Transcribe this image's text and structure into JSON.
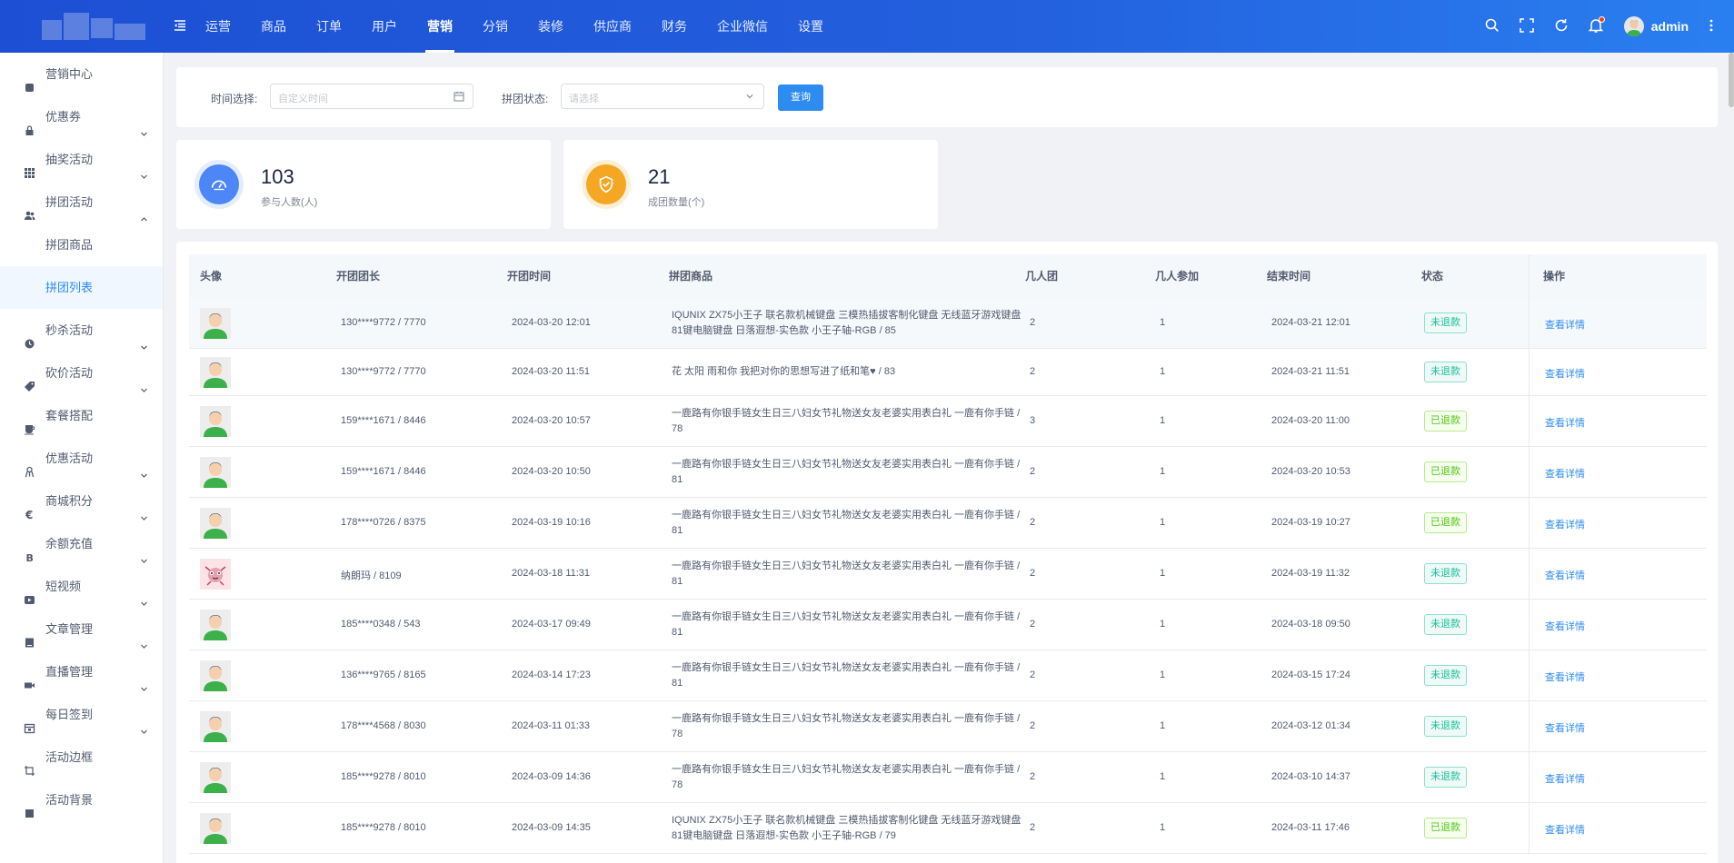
{
  "topbar": {
    "nav": [
      "运营",
      "商品",
      "订单",
      "用户",
      "营销",
      "分销",
      "装修",
      "供应商",
      "财务",
      "企业微信",
      "设置"
    ],
    "active_index": 4,
    "user": "admin"
  },
  "sidebar": {
    "items": [
      {
        "label": "营销中心",
        "icon": "shop-icon",
        "chevron": false
      },
      {
        "label": "优惠券",
        "icon": "lock-icon",
        "chevron": true
      },
      {
        "label": "抽奖活动",
        "icon": "grid-icon",
        "chevron": true
      },
      {
        "label": "拼团活动",
        "icon": "group-icon",
        "chevron": "up",
        "children": [
          {
            "label": "拼团商品",
            "active": false
          },
          {
            "label": "拼团列表",
            "active": true
          }
        ]
      },
      {
        "label": "秒杀活动",
        "icon": "clock-icon",
        "chevron": true
      },
      {
        "label": "砍价活动",
        "icon": "tag-icon",
        "chevron": true
      },
      {
        "label": "套餐搭配",
        "icon": "cup-icon",
        "chevron": false
      },
      {
        "label": "优惠活动",
        "icon": "gift-icon",
        "chevron": true
      },
      {
        "label": "商城积分",
        "icon": "euro-icon",
        "chevron": true
      },
      {
        "label": "余额充值",
        "icon": "bitcoin-icon",
        "chevron": true
      },
      {
        "label": "短视频",
        "icon": "video-icon",
        "chevron": true
      },
      {
        "label": "文章管理",
        "icon": "book-icon",
        "chevron": true
      },
      {
        "label": "直播管理",
        "icon": "camera-icon",
        "chevron": true
      },
      {
        "label": "每日签到",
        "icon": "calendar-icon",
        "chevron": true
      },
      {
        "label": "活动边框",
        "icon": "frame-icon",
        "chevron": false
      },
      {
        "label": "活动背景",
        "icon": "square-icon",
        "chevron": false
      }
    ]
  },
  "filter": {
    "time_label": "时间选择:",
    "time_placeholder": "自定义时间",
    "status_label": "拼团状态:",
    "status_placeholder": "请选择",
    "query": "查询"
  },
  "stats": [
    {
      "value": "103",
      "label": "参与人数(人)",
      "color": "#2d7cf6"
    },
    {
      "value": "21",
      "label": "成团数量(个)",
      "color": "#f5a623"
    }
  ],
  "table": {
    "columns": [
      "头像",
      "开团团长",
      "开团时间",
      "拼团商品",
      "几人团",
      "几人参加",
      "结束时间",
      "状态",
      "操作"
    ],
    "rows": [
      {
        "avatar": "default",
        "leader": "130****9772 / 7770",
        "start": "2024-03-20 12:01",
        "goods": "IQUNIX ZX75小王子 联名款机械键盘 三模热插拔客制化键盘 无线蓝牙游戏键盘 81键电脑键盘 日落遐想-实色款 小王子轴-RGB / 85",
        "team": "2",
        "joined": "1",
        "end": "2024-03-21 12:01",
        "status": "未退款",
        "status_type": "not",
        "op": "查看详情"
      },
      {
        "avatar": "default",
        "leader": "130****9772 / 7770",
        "start": "2024-03-20 11:51",
        "goods": "花 太阳 雨和你 我把对你的思想写进了纸和笔♥ / 83",
        "team": "2",
        "joined": "1",
        "end": "2024-03-21 11:51",
        "status": "未退款",
        "status_type": "not",
        "op": "查看详情"
      },
      {
        "avatar": "default",
        "leader": "159****1671 / 8446",
        "start": "2024-03-20 10:57",
        "goods": "一鹿路有你银手链女生日三八妇女节礼物送女友老婆实用表白礼 一鹿有你手链 / 78",
        "team": "3",
        "joined": "1",
        "end": "2024-03-20 11:00",
        "status": "已退款",
        "status_type": "done",
        "op": "查看详情"
      },
      {
        "avatar": "default",
        "leader": "159****1671 / 8446",
        "start": "2024-03-20 10:50",
        "goods": "一鹿路有你银手链女生日三八妇女节礼物送女友老婆实用表白礼 一鹿有你手链 / 81",
        "team": "2",
        "joined": "1",
        "end": "2024-03-20 10:53",
        "status": "已退款",
        "status_type": "done",
        "op": "查看详情"
      },
      {
        "avatar": "default",
        "leader": "178****0726 / 8375",
        "start": "2024-03-19 10:16",
        "goods": "一鹿路有你银手链女生日三八妇女节礼物送女友老婆实用表白礼 一鹿有你手链 / 81",
        "team": "2",
        "joined": "1",
        "end": "2024-03-19 10:27",
        "status": "已退款",
        "status_type": "done",
        "op": "查看详情"
      },
      {
        "avatar": "cartoon",
        "leader": "纳朗玛 / 8109",
        "start": "2024-03-18 11:31",
        "goods": "一鹿路有你银手链女生日三八妇女节礼物送女友老婆实用表白礼 一鹿有你手链 / 81",
        "team": "2",
        "joined": "1",
        "end": "2024-03-19 11:32",
        "status": "未退款",
        "status_type": "not",
        "op": "查看详情"
      },
      {
        "avatar": "default",
        "leader": "185****0348 / 543",
        "start": "2024-03-17 09:49",
        "goods": "一鹿路有你银手链女生日三八妇女节礼物送女友老婆实用表白礼 一鹿有你手链 / 81",
        "team": "2",
        "joined": "1",
        "end": "2024-03-18 09:50",
        "status": "未退款",
        "status_type": "not",
        "op": "查看详情"
      },
      {
        "avatar": "default",
        "leader": "136****9765 / 8165",
        "start": "2024-03-14 17:23",
        "goods": "一鹿路有你银手链女生日三八妇女节礼物送女友老婆实用表白礼 一鹿有你手链 / 81",
        "team": "2",
        "joined": "1",
        "end": "2024-03-15 17:24",
        "status": "未退款",
        "status_type": "not",
        "op": "查看详情"
      },
      {
        "avatar": "default",
        "leader": "178****4568 / 8030",
        "start": "2024-03-11 01:33",
        "goods": "一鹿路有你银手链女生日三八妇女节礼物送女友老婆实用表白礼 一鹿有你手链 / 78",
        "team": "2",
        "joined": "1",
        "end": "2024-03-12 01:34",
        "status": "未退款",
        "status_type": "not",
        "op": "查看详情"
      },
      {
        "avatar": "default",
        "leader": "185****9278 / 8010",
        "start": "2024-03-09 14:36",
        "goods": "一鹿路有你银手链女生日三八妇女节礼物送女友老婆实用表白礼 一鹿有你手链 / 78",
        "team": "2",
        "joined": "1",
        "end": "2024-03-10 14:37",
        "status": "未退款",
        "status_type": "not",
        "op": "查看详情"
      },
      {
        "avatar": "default",
        "leader": "185****9278 / 8010",
        "start": "2024-03-09 14:35",
        "goods": "IQUNIX ZX75小王子 联名款机械键盘 三模热插拔客制化键盘 无线蓝牙游戏键盘 81键电脑键盘 日落遐想-实色款 小王子轴-RGB / 79",
        "team": "2",
        "joined": "1",
        "end": "2024-03-11 17:46",
        "status": "已退款",
        "status_type": "done",
        "op": "查看详情"
      }
    ]
  }
}
